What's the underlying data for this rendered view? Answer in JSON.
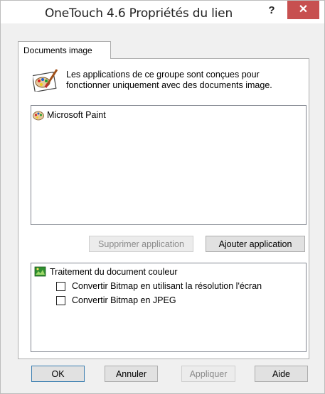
{
  "window": {
    "title": "OneTouch 4.6 Propriétés du lien",
    "help_label": "?",
    "close_label": "✕"
  },
  "tab": {
    "label": "Documents image"
  },
  "description": "Les applications de ce groupe sont conçues pour fonctionner uniquement avec des documents image.",
  "apps": [
    {
      "label": "Microsoft Paint",
      "icon": "paint-palette-icon"
    }
  ],
  "app_buttons": {
    "remove": "Supprimer application",
    "add": "Ajouter application"
  },
  "options": {
    "root": "Traitement du document couleur",
    "items": [
      {
        "label": "Convertir Bitmap en utilisant la résolution l'écran",
        "checked": false
      },
      {
        "label": "Convertir Bitmap en JPEG",
        "checked": false
      }
    ]
  },
  "footer": {
    "ok": "OK",
    "cancel": "Annuler",
    "apply": "Appliquer",
    "help": "Aide"
  }
}
